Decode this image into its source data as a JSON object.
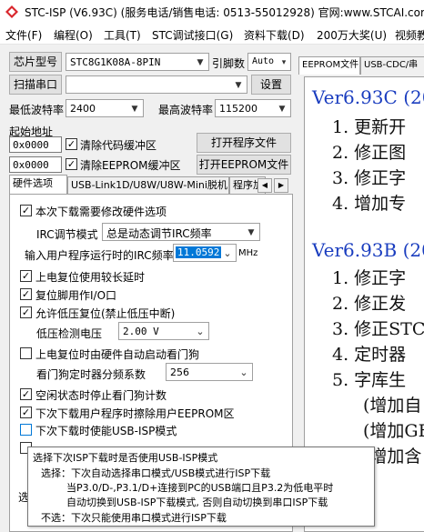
{
  "window": {
    "title": "STC-ISP (V6.93C) (服务电话/销售电话: 0513-55012928) 官网:www.STCAI.com"
  },
  "menu": [
    "文件(F)",
    "编程(O)",
    "工具(T)",
    "STC调试接口(G)",
    "资料下载(D)",
    "200万大奖(U)",
    "视频教"
  ],
  "controls": {
    "chip_type_label": "芯片型号",
    "chip_type_value": "STC8G1K08A-8PIN",
    "pin_count_label": "引脚数",
    "pin_count_value": "Auto",
    "scan_port_button": "扫描串口",
    "port_value": "",
    "settings_button": "设置",
    "min_baud_label": "最低波特率",
    "min_baud_value": "2400",
    "max_baud_label": "最高波特率",
    "max_baud_value": "115200",
    "start_addr_label": "起始地址",
    "code_addr_value": "0x0000",
    "clear_code_label": "清除代码缓冲区",
    "open_program_button": "打开程序文件",
    "eeprom_addr_value": "0x0000",
    "clear_eeprom_label": "清除EEPROM缓冲区",
    "open_eeprom_button": "打开EEPROM文件"
  },
  "left_tabs": [
    "硬件选项",
    "USB-Link1D/U8W/U8W-Mini脱机",
    "程序加"
  ],
  "hw_options": {
    "opt1": "本次下载需要修改硬件选项",
    "irc_mode_label": "IRC调节模式",
    "irc_mode_value": "总是动态调节IRC频率",
    "irc_freq_label": "输入用户程序运行时的IRC频率",
    "irc_freq_value": "11.0592",
    "irc_freq_unit": "MHz",
    "opt2": "上电复位使用较长延时",
    "opt3": "复位脚用作I/O口",
    "opt4": "允许低压复位(禁止低压中断)",
    "lvd_label": "低压检测电压",
    "lvd_value": "2.00 V",
    "opt5": "上电复位时由硬件自动启动看门狗",
    "wdt_label": "看门狗定时器分频系数",
    "wdt_value": "256",
    "opt6": "空闲状态时停止看门狗计数",
    "opt7": "下次下载用户程序时擦除用户EEPROM区",
    "opt8": "下次下载时使能USB-ISP模式"
  },
  "right_tabs": [
    "EEPROM文件",
    "USB-CDC/串"
  ],
  "release_notes": {
    "v1": "Ver6.93C (20",
    "v1_items": [
      "1. 更新开",
      "2. 修正图",
      "3. 修正字",
      "4. 增加专"
    ],
    "v2": "Ver6.93B (20",
    "v2_items": [
      "1. 修正字",
      "2. 修正发",
      "3. 修正STC",
      "4. 定时器",
      "5. 字库生"
    ],
    "v2_sub": [
      "(增加自",
      "(增加GE",
      "(增加含"
    ]
  },
  "tooltip": {
    "title": "选择下次ISP下载时是否使用USB-ISP模式",
    "l1": "选择：下次自动选择串口模式/USB模式进行ISP下载",
    "l2": "当P3.0/D-,P3.1/D+连接到PC的USB端口且P3.2为低电平时",
    "l3": "自动切换到USB-ISP下载模式, 否则自动切换到串口ISP下载",
    "l4": "不选：下次只能使用串口模式进行ISP下载"
  },
  "bottom_label": "选"
}
